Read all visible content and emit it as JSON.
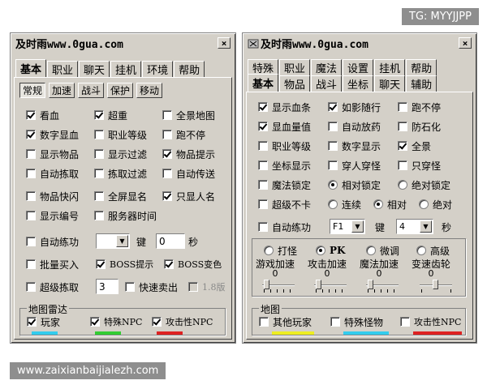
{
  "watermarks": {
    "top": "TG: MYYJJPP",
    "bottom": "www.zaixianbaijialezh.com"
  },
  "left": {
    "title": "及时雨www.0gua.com",
    "close": "×",
    "tabs": [
      "基本",
      "职业",
      "聊天",
      "挂机",
      "环境",
      "帮助"
    ],
    "subtabs": [
      "常规",
      "加速",
      "战斗",
      "保护",
      "移动"
    ],
    "options": [
      {
        "label": "看血",
        "checked": true
      },
      {
        "label": "超重",
        "checked": true
      },
      {
        "label": "全景地图",
        "checked": false
      },
      {
        "label": "数字显血",
        "checked": true
      },
      {
        "label": "职业等级",
        "checked": false
      },
      {
        "label": "跑不停",
        "checked": false
      },
      {
        "label": "显示物品",
        "checked": false
      },
      {
        "label": "显示过滤",
        "checked": false
      },
      {
        "label": "物品提示",
        "checked": true
      },
      {
        "label": "自动拣取",
        "checked": false
      },
      {
        "label": "拣取过滤",
        "checked": false
      },
      {
        "label": "自动传送",
        "checked": false
      },
      {
        "label": "物品快闪",
        "checked": false
      },
      {
        "label": "全屏显名",
        "checked": false
      },
      {
        "label": "只显人名",
        "checked": true
      },
      {
        "label": "显示编号",
        "checked": false
      },
      {
        "label": "服务器时间",
        "checked": false
      }
    ],
    "autopractice": {
      "label": "自动练功",
      "key_label": "键",
      "key_value": "0",
      "sec_label": "秒"
    },
    "row_batch": [
      {
        "label": "批量买入",
        "checked": false
      },
      {
        "label": "BOSS提示",
        "checked": true
      },
      {
        "label": "BOSS变色",
        "checked": true
      }
    ],
    "row_pick": {
      "label": "超级拣取",
      "value": "3"
    },
    "row_sell": {
      "label": "快速卖出",
      "checked": false
    },
    "row_ver": {
      "label": "1.8版",
      "checked": false
    },
    "map_group": {
      "title": "地图雷达",
      "items": [
        {
          "label": "玩家",
          "checked": true,
          "color": "#33ccee"
        },
        {
          "label": "特殊NPC",
          "checked": true,
          "color": "#33cc33"
        },
        {
          "label": "攻击性NPC",
          "checked": true,
          "color": "#dd2222"
        }
      ]
    }
  },
  "right": {
    "title": "及时雨www.0gua.com",
    "close": "×",
    "tabs_row1": [
      "特殊",
      "职业",
      "魔法",
      "设置",
      "挂机",
      "帮助"
    ],
    "tabs_row2": [
      "基本",
      "物品",
      "战斗",
      "坐标",
      "聊天",
      "辅助"
    ],
    "options": [
      {
        "label": "显示血条",
        "checked": true
      },
      {
        "label": "如影随行",
        "checked": true
      },
      {
        "label": "跑不停",
        "checked": false
      },
      {
        "label": "显血量值",
        "checked": true
      },
      {
        "label": "自动放药",
        "checked": false
      },
      {
        "label": "防石化",
        "checked": false
      },
      {
        "label": "职业等级",
        "checked": false
      },
      {
        "label": "数字显示",
        "checked": false
      },
      {
        "label": "全景",
        "checked": true
      },
      {
        "label": "坐标显示",
        "checked": false
      },
      {
        "label": "穿人穿怪",
        "checked": false
      },
      {
        "label": "只穿怪",
        "checked": false
      }
    ],
    "magic_lock": {
      "label": "魔法锁定",
      "checked": false,
      "radios": [
        {
          "label": "相对锁定",
          "selected": true
        },
        {
          "label": "绝对锁定",
          "selected": false
        }
      ]
    },
    "super_nocard": {
      "label": "超级不卡",
      "checked": false,
      "radios": [
        {
          "label": "连续",
          "selected": false
        },
        {
          "label": "相对",
          "selected": true
        },
        {
          "label": "绝对",
          "selected": false
        }
      ]
    },
    "autopractice": {
      "label": "自动练功",
      "key": "F1",
      "key_label": "键",
      "value": "4",
      "sec_label": "秒"
    },
    "speed": {
      "radios": [
        {
          "label": "打怪",
          "selected": false
        },
        {
          "label": "PK",
          "selected": true
        },
        {
          "label": "微调",
          "selected": false
        },
        {
          "label": "高级",
          "selected": false
        }
      ],
      "labels": [
        "游戏加速",
        "攻击加速",
        "魔法加速",
        "变速齿轮"
      ],
      "values": [
        "0",
        "0",
        "0",
        "0"
      ]
    },
    "map_group": {
      "title": "地图",
      "items": [
        {
          "label": "其他玩家",
          "checked": false,
          "color": "#eeee22"
        },
        {
          "label": "特殊怪物",
          "checked": false,
          "color": "#33ccee"
        },
        {
          "label": "攻击性NPC",
          "checked": false,
          "color": "#dd2222"
        }
      ]
    }
  }
}
